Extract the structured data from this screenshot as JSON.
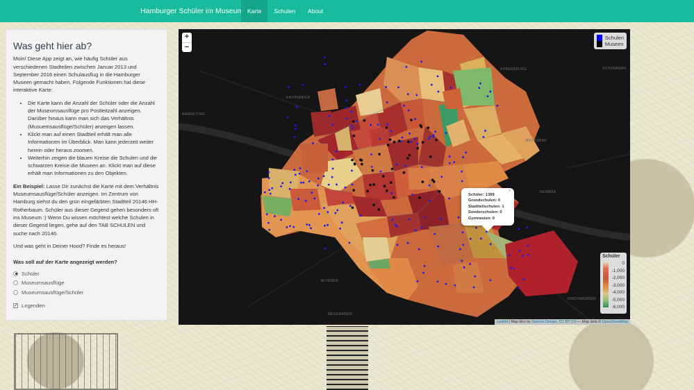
{
  "navbar": {
    "brand": "Hamburger Schüler im Museum",
    "tabs": [
      {
        "label": "Karte",
        "active": true
      },
      {
        "label": "Schulen",
        "active": false
      },
      {
        "label": "About",
        "active": false
      }
    ],
    "color": "#18bc9c"
  },
  "panel": {
    "title": "Was geht hier ab?",
    "intro": "Moin! Diese App zeigt an, wie häufig Schüler aus verschiedenen Stadteilen zwischen Januar 2013 und September 2016 einen Schulausflug in die Hamburger Museen gemacht haben. Folgende Funktionen hat diese interaktive Karte:",
    "bullets": [
      "Die Karte kann die Anzahl der Schüler oder die Anzahl der Museumsausflüge pro Postleitzahl anzeigen. Darüber hinaus kann man sich das Verhältnis (Musuemsausflüge/Schüler) anzeigen lassen.",
      "Klickt man auf einen Stadtteil erhält man alle Informationen im Überblick. Man kann jederzeit weiter herein oder heraus zoomen.",
      "Weiterhin zeigen die blauen Kreise die Schulen und die schwarzen Kreise die Museen an. Klickt man auf diese erhält man Informationen zu den Objekten."
    ],
    "example_label": "Ein Beispiel:",
    "example_text": " Lasse Dir zunächst die Karte mit dem Verhältnis Museumsausflüge/Schüler anzeigen. Im Zentrum von Hamburg siehst du den grün eingefärbten Stadtteil 20146 HH-Rotherbaum. Schüler aus dieser Gegend gehen besonders oft ins Museum :) Wenn Du wissen möchtest welche Schulen in dieser Gegend liegen, gehe auf den TAB SCHULEN und suche nach 20146.",
    "outro": "Und was geht in Deiner Hood? Finde es heraus!",
    "question": "Was soll auf der Karte angezeigt werden?",
    "options": [
      {
        "label": "Schüler",
        "selected": true
      },
      {
        "label": "Museumsausflüge",
        "selected": false
      },
      {
        "label": "Museumsausflüge/Schüler",
        "selected": false
      }
    ],
    "checkbox": {
      "label": "Legenden",
      "checked": true
    }
  },
  "map": {
    "zoom_in": "+",
    "zoom_out": "−",
    "legend_markers": [
      {
        "label": "Schulen",
        "color": "#0000ff"
      },
      {
        "label": "Museen",
        "color": "#000000"
      }
    ],
    "legend_scale": {
      "title": "Schüler",
      "ticks": [
        "0",
        "-1,000",
        "-2,000",
        "-3,000",
        "-4,000",
        "-5,000",
        "-6,000"
      ]
    },
    "attribution": {
      "leaflet": "Leaflet",
      "text1": " | Map tiles by ",
      "stamen": "Stamen Design",
      "text2": ", ",
      "license": "CC BY 3.0",
      "text3": " — Map data © ",
      "osm": "OpenStreetMap"
    },
    "popup": {
      "rows": [
        "Schüler: 1389",
        "Grundschulen: 0",
        "Stadtteilschulen: 1",
        "Sonderschulen: 0",
        "Gymnasien: 0"
      ],
      "close": "×"
    },
    "place_labels": [
      "AHRENSBURG",
      "SCHÖNBERG",
      "BRUNSBEK",
      "REINBEK",
      "KIRCHWERDER",
      "NEUGRABEN",
      "ALVESEN",
      "BARNSTORF",
      "KRUPUNDER"
    ]
  }
}
